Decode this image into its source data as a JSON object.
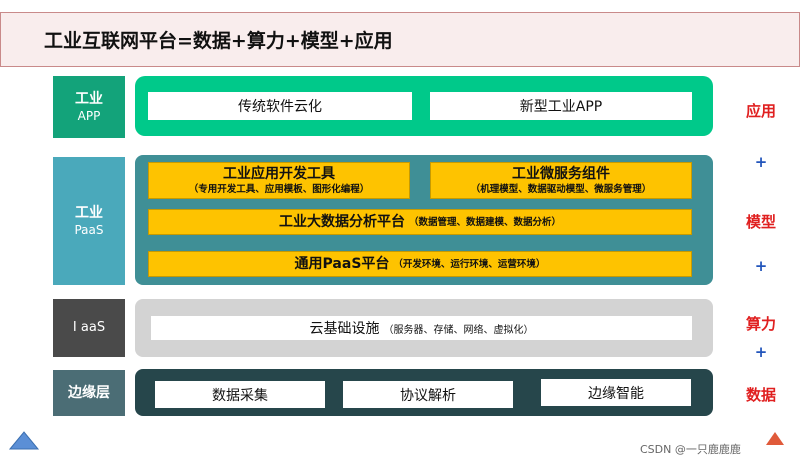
{
  "title": "工业互联网平台=数据+算力+模型+应用",
  "layers": {
    "app": {
      "label_main": "工业",
      "label_sub": "APP",
      "boxes": [
        "传统软件云化",
        "新型工业APP"
      ]
    },
    "paas": {
      "label_main": "工业",
      "label_sub": "PaaS",
      "tool": {
        "title": "工业应用开发工具",
        "sub": "（专用开发工具、应用模板、图形化编程）"
      },
      "micro": {
        "title": "工业微服务组件",
        "sub": "（机理模型、数据驱动模型、微服务管理）"
      },
      "bigdata": {
        "title": "工业大数据分析平台",
        "sub": "（数据管理、数据建模、数据分析）"
      },
      "general": {
        "title": "通用PaaS平台",
        "sub": "（开发环境、运行环境、运营环境）"
      }
    },
    "iaas": {
      "label": "I aaS",
      "box_main": "云基础设施",
      "box_sub": "（服务器、存储、网络、虚拟化）"
    },
    "edge": {
      "label": "边缘层",
      "boxes": [
        "数据采集",
        "协议解析",
        "边缘智能"
      ]
    }
  },
  "right_labels": {
    "app": "应用",
    "model": "模型",
    "compute": "算力",
    "data": "数据",
    "plus": "+"
  },
  "watermark": "CSDN @一只鹿鹿鹿",
  "colors": {
    "app_green": "#00c98a",
    "app_label": "#13a37a",
    "paas_teal": "#3f8f96",
    "paas_label": "#4aa9bb",
    "iaas_grey": "#d3d3d3",
    "iaas_label": "#4a4a4a",
    "edge_dark": "#26464b",
    "edge_label": "#4b6d75",
    "gold": "#fec300",
    "accent_red": "#e02020",
    "plus_blue": "#2255bb"
  }
}
